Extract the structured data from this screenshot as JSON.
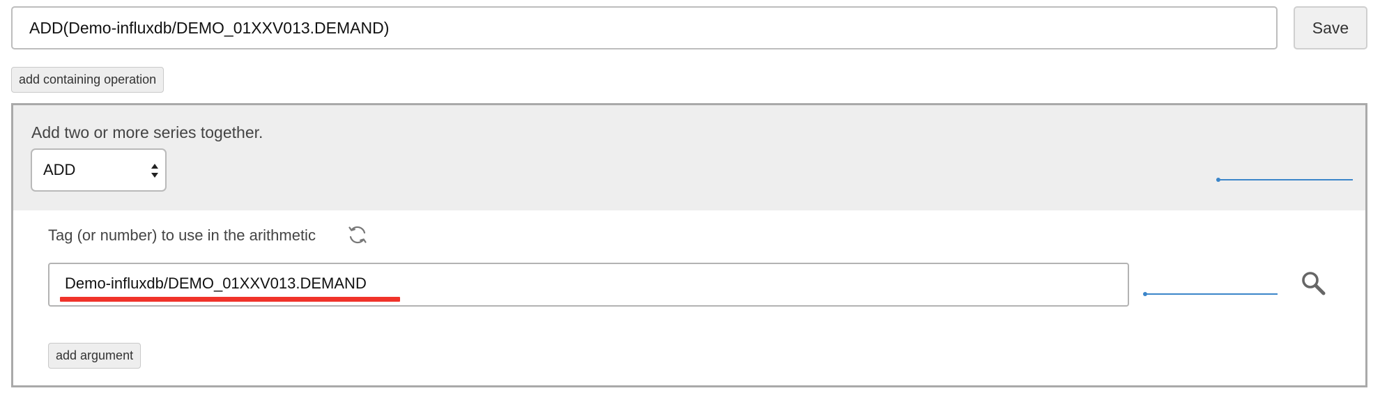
{
  "expression": {
    "value": "ADD(Demo-influxdb/DEMO_01XXV013.DEMAND)"
  },
  "toolbar": {
    "save_label": "Save",
    "add_containing_label": "add containing operation"
  },
  "operation": {
    "description": "Add two or more series together.",
    "selected": "ADD"
  },
  "argument": {
    "label": "Tag (or number) to use in the arithmetic",
    "tag_value": "Demo-influxdb/DEMO_01XXV013.DEMAND",
    "add_argument_label": "add argument"
  },
  "colors": {
    "accent_line": "#3b85c9",
    "highlight_underline": "#f0332a",
    "panel_header_bg": "#eeeeee"
  },
  "icons": {
    "refresh": "refresh-icon",
    "search": "search-icon",
    "select": "chevron-up-down-icon"
  }
}
